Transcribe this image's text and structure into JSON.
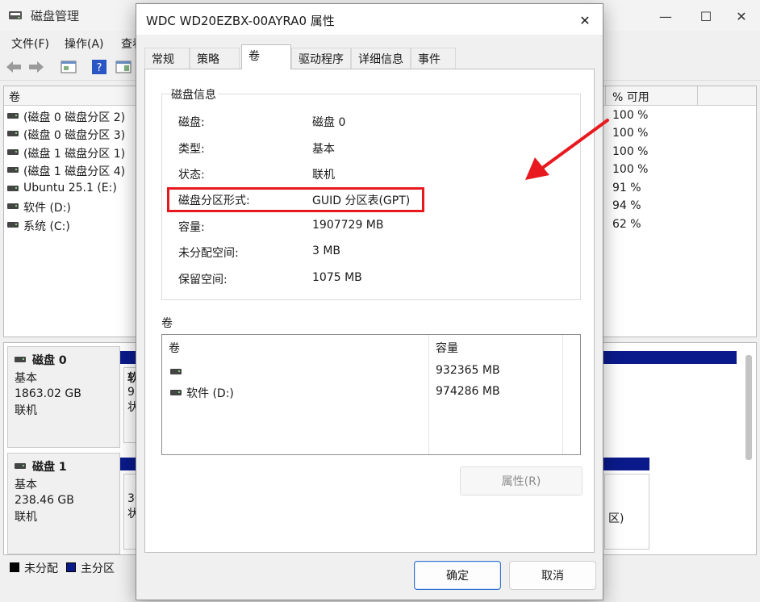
{
  "main": {
    "title": "磁盘管理",
    "menu": [
      "文件(F)",
      "操作(A)",
      "查看"
    ],
    "vol_header": {
      "name": "卷",
      "pct": "% 可用"
    },
    "volumes": [
      {
        "name": "(磁盘 0 磁盘分区 2)",
        "pct": "100 %"
      },
      {
        "name": "(磁盘 0 磁盘分区 3)",
        "pct": "100 %"
      },
      {
        "name": "(磁盘 1 磁盘分区 1)",
        "pct": "100 %"
      },
      {
        "name": "(磁盘 1 磁盘分区 4)",
        "pct": "100 %"
      },
      {
        "name": "Ubuntu 25.1 (E:)",
        "pct": "91 %"
      },
      {
        "name": "软件 (D:)",
        "pct": "94 %"
      },
      {
        "name": "系统 (C:)",
        "pct": "62 %"
      }
    ],
    "disks": [
      {
        "name": "磁盘 0",
        "type": "基本",
        "size": "1863.02 GB",
        "status": "联机",
        "part_text": [
          "软",
          "95",
          "状"
        ]
      },
      {
        "name": "磁盘 1",
        "type": "基本",
        "size": "238.46 GB",
        "status": "联机",
        "part_text": [
          "30",
          "状"
        ],
        "right_text": "区)"
      }
    ],
    "legend": [
      {
        "label": "未分配",
        "color": "#000000"
      },
      {
        "label": "主分区",
        "color": "#0a1a8a"
      }
    ]
  },
  "dialog": {
    "title": "WDC WD20EZBX-00AYRA0 属性",
    "tabs": [
      "常规",
      "策略",
      "卷",
      "驱动程序",
      "详细信息",
      "事件"
    ],
    "active_tab": "卷",
    "disk_info": {
      "group_title": "磁盘信息",
      "rows": [
        {
          "label": "磁盘:",
          "value": "磁盘 0"
        },
        {
          "label": "类型:",
          "value": "基本"
        },
        {
          "label": "状态:",
          "value": "联机"
        },
        {
          "label": "磁盘分区形式:",
          "value": "GUID 分区表(GPT)"
        },
        {
          "label": "容量:",
          "value": "1907729 MB"
        },
        {
          "label": "未分配空间:",
          "value": "3 MB"
        },
        {
          "label": "保留空间:",
          "value": "1075 MB"
        }
      ]
    },
    "volumes": {
      "title": "卷",
      "col_volume": "卷",
      "col_capacity": "容量",
      "rows": [
        {
          "name": "",
          "capacity": "932365 MB"
        },
        {
          "name": "软件 (D:)",
          "capacity": "974286 MB"
        }
      ]
    },
    "properties_button": "属性(R)",
    "ok_button": "确定",
    "cancel_button": "取消"
  },
  "colors": {
    "highlight": "#e8191e",
    "partition_bar": "#0a1a8a",
    "accent": "#2f6fd0"
  }
}
